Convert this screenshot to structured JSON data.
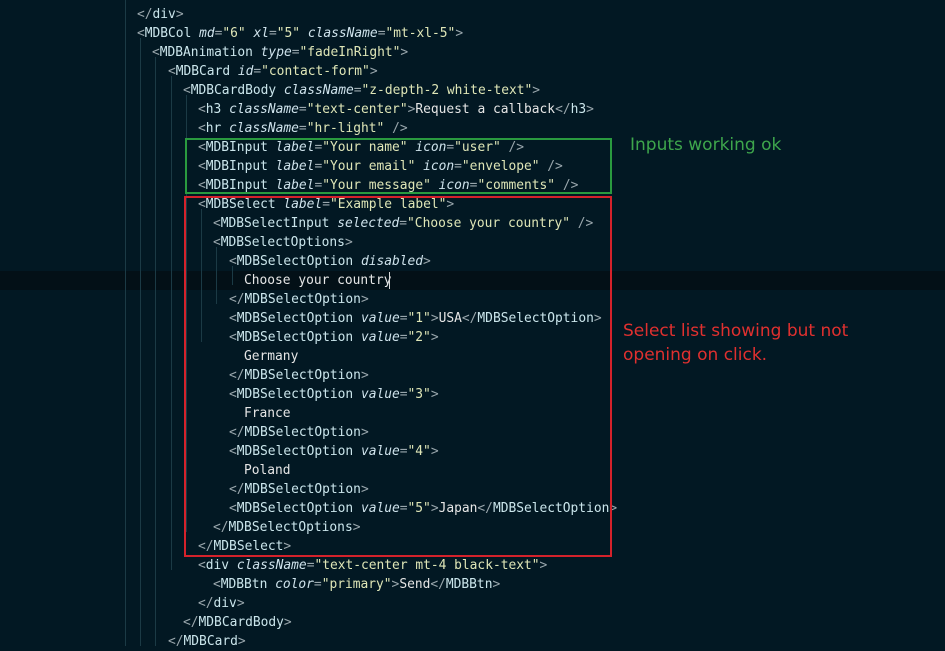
{
  "lines": [
    {
      "segments": [
        {
          "t": "p",
          "v": "</"
        },
        {
          "t": "tag",
          "v": "div"
        },
        {
          "t": "p",
          "v": ">"
        }
      ]
    },
    {
      "segments": [
        {
          "t": "p",
          "v": "<"
        },
        {
          "t": "tag",
          "v": "MDBCol"
        },
        {
          "t": "sp",
          "v": " "
        },
        {
          "t": "attr",
          "v": "md"
        },
        {
          "t": "p",
          "v": "="
        },
        {
          "t": "str",
          "v": "\"6\""
        },
        {
          "t": "sp",
          "v": " "
        },
        {
          "t": "attr",
          "v": "xl"
        },
        {
          "t": "p",
          "v": "="
        },
        {
          "t": "str",
          "v": "\"5\""
        },
        {
          "t": "sp",
          "v": " "
        },
        {
          "t": "attr",
          "v": "className"
        },
        {
          "t": "p",
          "v": "="
        },
        {
          "t": "str",
          "v": "\"mt-xl-5\""
        },
        {
          "t": "p",
          "v": ">"
        }
      ]
    },
    {
      "segments": [
        {
          "t": "p",
          "v": "<"
        },
        {
          "t": "tag",
          "v": "MDBAnimation"
        },
        {
          "t": "sp",
          "v": " "
        },
        {
          "t": "attr",
          "v": "type"
        },
        {
          "t": "p",
          "v": "="
        },
        {
          "t": "str",
          "v": "\"fadeInRight\""
        },
        {
          "t": "p",
          "v": ">"
        }
      ]
    },
    {
      "segments": [
        {
          "t": "p",
          "v": "<"
        },
        {
          "t": "tag",
          "v": "MDBCard"
        },
        {
          "t": "sp",
          "v": " "
        },
        {
          "t": "attr",
          "v": "id"
        },
        {
          "t": "p",
          "v": "="
        },
        {
          "t": "str",
          "v": "\"contact-form\""
        },
        {
          "t": "p",
          "v": ">"
        }
      ]
    },
    {
      "segments": [
        {
          "t": "p",
          "v": "<"
        },
        {
          "t": "tag",
          "v": "MDBCardBody"
        },
        {
          "t": "sp",
          "v": " "
        },
        {
          "t": "attr",
          "v": "className"
        },
        {
          "t": "p",
          "v": "="
        },
        {
          "t": "str",
          "v": "\"z-depth-2 white-text\""
        },
        {
          "t": "p",
          "v": ">"
        }
      ]
    },
    {
      "segments": [
        {
          "t": "p",
          "v": "<"
        },
        {
          "t": "tag",
          "v": "h3"
        },
        {
          "t": "sp",
          "v": " "
        },
        {
          "t": "attr",
          "v": "className"
        },
        {
          "t": "p",
          "v": "="
        },
        {
          "t": "str",
          "v": "\"text-center\""
        },
        {
          "t": "p",
          "v": ">"
        },
        {
          "t": "txt",
          "v": "Request a callback"
        },
        {
          "t": "p",
          "v": "</"
        },
        {
          "t": "tag",
          "v": "h3"
        },
        {
          "t": "p",
          "v": ">"
        }
      ]
    },
    {
      "segments": [
        {
          "t": "p",
          "v": "<"
        },
        {
          "t": "tag",
          "v": "hr"
        },
        {
          "t": "sp",
          "v": " "
        },
        {
          "t": "attr",
          "v": "className"
        },
        {
          "t": "p",
          "v": "="
        },
        {
          "t": "str",
          "v": "\"hr-light\""
        },
        {
          "t": "sp",
          "v": " "
        },
        {
          "t": "p",
          "v": "/>"
        }
      ]
    },
    {
      "segments": [
        {
          "t": "p",
          "v": "<"
        },
        {
          "t": "tag",
          "v": "MDBInput"
        },
        {
          "t": "sp",
          "v": " "
        },
        {
          "t": "attr",
          "v": "label"
        },
        {
          "t": "p",
          "v": "="
        },
        {
          "t": "str",
          "v": "\"Your name\""
        },
        {
          "t": "sp",
          "v": " "
        },
        {
          "t": "attr",
          "v": "icon"
        },
        {
          "t": "p",
          "v": "="
        },
        {
          "t": "str",
          "v": "\"user\""
        },
        {
          "t": "sp",
          "v": " "
        },
        {
          "t": "p",
          "v": "/>"
        }
      ]
    },
    {
      "segments": [
        {
          "t": "p",
          "v": "<"
        },
        {
          "t": "tag",
          "v": "MDBInput"
        },
        {
          "t": "sp",
          "v": " "
        },
        {
          "t": "attr",
          "v": "label"
        },
        {
          "t": "p",
          "v": "="
        },
        {
          "t": "str",
          "v": "\"Your email\""
        },
        {
          "t": "sp",
          "v": " "
        },
        {
          "t": "attr",
          "v": "icon"
        },
        {
          "t": "p",
          "v": "="
        },
        {
          "t": "str",
          "v": "\"envelope\""
        },
        {
          "t": "sp",
          "v": " "
        },
        {
          "t": "p",
          "v": "/>"
        }
      ]
    },
    {
      "segments": [
        {
          "t": "p",
          "v": "<"
        },
        {
          "t": "tag",
          "v": "MDBInput"
        },
        {
          "t": "sp",
          "v": " "
        },
        {
          "t": "attr",
          "v": "label"
        },
        {
          "t": "p",
          "v": "="
        },
        {
          "t": "str",
          "v": "\"Your message\""
        },
        {
          "t": "sp",
          "v": " "
        },
        {
          "t": "attr",
          "v": "icon"
        },
        {
          "t": "p",
          "v": "="
        },
        {
          "t": "str",
          "v": "\"comments\""
        },
        {
          "t": "sp",
          "v": " "
        },
        {
          "t": "p",
          "v": "/>"
        }
      ]
    },
    {
      "segments": [
        {
          "t": "p",
          "v": "<"
        },
        {
          "t": "tag",
          "v": "MDBSelect"
        },
        {
          "t": "sp",
          "v": " "
        },
        {
          "t": "attr",
          "v": "label"
        },
        {
          "t": "p",
          "v": "="
        },
        {
          "t": "str",
          "v": "\"Example label\""
        },
        {
          "t": "p",
          "v": ">"
        }
      ]
    },
    {
      "segments": [
        {
          "t": "p",
          "v": "<"
        },
        {
          "t": "tag",
          "v": "MDBSelectInput"
        },
        {
          "t": "sp",
          "v": " "
        },
        {
          "t": "attr",
          "v": "selected"
        },
        {
          "t": "p",
          "v": "="
        },
        {
          "t": "str",
          "v": "\"Choose your country\""
        },
        {
          "t": "sp",
          "v": " "
        },
        {
          "t": "p",
          "v": "/>"
        }
      ]
    },
    {
      "segments": [
        {
          "t": "p",
          "v": "<"
        },
        {
          "t": "tag",
          "v": "MDBSelectOptions"
        },
        {
          "t": "p",
          "v": ">"
        }
      ]
    },
    {
      "segments": [
        {
          "t": "p",
          "v": "<"
        },
        {
          "t": "tag",
          "v": "MDBSelectOption"
        },
        {
          "t": "sp",
          "v": " "
        },
        {
          "t": "attr",
          "v": "disabled"
        },
        {
          "t": "p",
          "v": ">"
        }
      ]
    },
    {
      "segments": [
        {
          "t": "txt",
          "v": "Choose your country"
        }
      ]
    },
    {
      "segments": [
        {
          "t": "p",
          "v": "</"
        },
        {
          "t": "tag",
          "v": "MDBSelectOption"
        },
        {
          "t": "p",
          "v": ">"
        }
      ]
    },
    {
      "segments": [
        {
          "t": "p",
          "v": "<"
        },
        {
          "t": "tag",
          "v": "MDBSelectOption"
        },
        {
          "t": "sp",
          "v": " "
        },
        {
          "t": "attr",
          "v": "value"
        },
        {
          "t": "p",
          "v": "="
        },
        {
          "t": "str",
          "v": "\"1\""
        },
        {
          "t": "p",
          "v": ">"
        },
        {
          "t": "txt",
          "v": "USA"
        },
        {
          "t": "p",
          "v": "</"
        },
        {
          "t": "tag",
          "v": "MDBSelectOption"
        },
        {
          "t": "p",
          "v": ">"
        }
      ]
    },
    {
      "segments": [
        {
          "t": "p",
          "v": "<"
        },
        {
          "t": "tag",
          "v": "MDBSelectOption"
        },
        {
          "t": "sp",
          "v": " "
        },
        {
          "t": "attr",
          "v": "value"
        },
        {
          "t": "p",
          "v": "="
        },
        {
          "t": "str",
          "v": "\"2\""
        },
        {
          "t": "p",
          "v": ">"
        }
      ]
    },
    {
      "segments": [
        {
          "t": "txt",
          "v": "Germany"
        }
      ]
    },
    {
      "segments": [
        {
          "t": "p",
          "v": "</"
        },
        {
          "t": "tag",
          "v": "MDBSelectOption"
        },
        {
          "t": "p",
          "v": ">"
        }
      ]
    },
    {
      "segments": [
        {
          "t": "p",
          "v": "<"
        },
        {
          "t": "tag",
          "v": "MDBSelectOption"
        },
        {
          "t": "sp",
          "v": " "
        },
        {
          "t": "attr",
          "v": "value"
        },
        {
          "t": "p",
          "v": "="
        },
        {
          "t": "str",
          "v": "\"3\""
        },
        {
          "t": "p",
          "v": ">"
        }
      ]
    },
    {
      "segments": [
        {
          "t": "txt",
          "v": "France"
        }
      ]
    },
    {
      "segments": [
        {
          "t": "p",
          "v": "</"
        },
        {
          "t": "tag",
          "v": "MDBSelectOption"
        },
        {
          "t": "p",
          "v": ">"
        }
      ]
    },
    {
      "segments": [
        {
          "t": "p",
          "v": "<"
        },
        {
          "t": "tag",
          "v": "MDBSelectOption"
        },
        {
          "t": "sp",
          "v": " "
        },
        {
          "t": "attr",
          "v": "value"
        },
        {
          "t": "p",
          "v": "="
        },
        {
          "t": "str",
          "v": "\"4\""
        },
        {
          "t": "p",
          "v": ">"
        }
      ]
    },
    {
      "segments": [
        {
          "t": "txt",
          "v": "Poland"
        }
      ]
    },
    {
      "segments": [
        {
          "t": "p",
          "v": "</"
        },
        {
          "t": "tag",
          "v": "MDBSelectOption"
        },
        {
          "t": "p",
          "v": ">"
        }
      ]
    },
    {
      "segments": [
        {
          "t": "p",
          "v": "<"
        },
        {
          "t": "tag",
          "v": "MDBSelectOption"
        },
        {
          "t": "sp",
          "v": " "
        },
        {
          "t": "attr",
          "v": "value"
        },
        {
          "t": "p",
          "v": "="
        },
        {
          "t": "str",
          "v": "\"5\""
        },
        {
          "t": "p",
          "v": ">"
        },
        {
          "t": "txt",
          "v": "Japan"
        },
        {
          "t": "p",
          "v": "</"
        },
        {
          "t": "tag",
          "v": "MDBSelectOption"
        },
        {
          "t": "p",
          "v": ">"
        }
      ]
    },
    {
      "segments": [
        {
          "t": "p",
          "v": "</"
        },
        {
          "t": "tag",
          "v": "MDBSelectOptions"
        },
        {
          "t": "p",
          "v": ">"
        }
      ]
    },
    {
      "segments": [
        {
          "t": "p",
          "v": "</"
        },
        {
          "t": "tag",
          "v": "MDBSelect"
        },
        {
          "t": "p",
          "v": ">"
        }
      ]
    },
    {
      "segments": [
        {
          "t": "p",
          "v": "<"
        },
        {
          "t": "tag",
          "v": "div"
        },
        {
          "t": "sp",
          "v": " "
        },
        {
          "t": "attr",
          "v": "className"
        },
        {
          "t": "p",
          "v": "="
        },
        {
          "t": "str",
          "v": "\"text-center mt-4 black-text\""
        },
        {
          "t": "p",
          "v": ">"
        }
      ]
    },
    {
      "segments": [
        {
          "t": "p",
          "v": "<"
        },
        {
          "t": "tag",
          "v": "MDBBtn"
        },
        {
          "t": "sp",
          "v": " "
        },
        {
          "t": "attr",
          "v": "color"
        },
        {
          "t": "p",
          "v": "="
        },
        {
          "t": "str",
          "v": "\"primary\""
        },
        {
          "t": "p",
          "v": ">"
        },
        {
          "t": "txt",
          "v": "Send"
        },
        {
          "t": "p",
          "v": "</"
        },
        {
          "t": "tag",
          "v": "MDBBtn"
        },
        {
          "t": "p",
          "v": ">"
        }
      ]
    },
    {
      "segments": [
        {
          "t": "p",
          "v": "</"
        },
        {
          "t": "tag",
          "v": "div"
        },
        {
          "t": "p",
          "v": ">"
        }
      ]
    },
    {
      "segments": [
        {
          "t": "p",
          "v": "</"
        },
        {
          "t": "tag",
          "v": "MDBCardBody"
        },
        {
          "t": "p",
          "v": ">"
        }
      ]
    },
    {
      "segments": [
        {
          "t": "p",
          "v": "</"
        },
        {
          "t": "tag",
          "v": "MDBCard"
        },
        {
          "t": "p",
          "v": ">"
        }
      ]
    }
  ],
  "annotations": {
    "green_note": "Inputs working ok",
    "red_note": "Select list showing but not opening on click."
  },
  "colors": {
    "background": "#021823",
    "green_box": "#2a9a3f",
    "red_box": "#d5222b"
  }
}
